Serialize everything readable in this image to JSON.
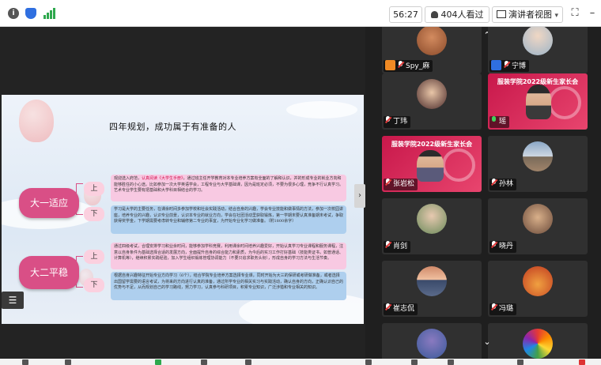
{
  "topbar": {
    "info_icon": "i",
    "shield_icon": "shield-icon",
    "signal_icon": "signal-icon",
    "timer": "56:27",
    "viewers": "404人看过",
    "presenter_view_label": "演讲者视图",
    "presenter_view_caret": "▾",
    "fullscreen_icon": "⛶",
    "minimize_icon": "–"
  },
  "slide": {
    "title": "四年规划，成功属于有准备的人",
    "menu_icon": "☰",
    "year1": {
      "label": "大一适应",
      "term1_label": "上",
      "term2_label": "下",
      "term1_text_pre": "观迎选入府范，",
      "term1_text_highlight": "认真阅读《大学生手册》",
      "term1_text_post": "，通过班主任开学教育对本专业培养方案有全面的了解和认识，并的形成专业的就业方向和能够胜任的小心途。比如参加一次大学英语学会，工程专业与大学基础课，因为是班定必须，不要为很多心理，竞争不行认真学习。艺术专业学生要有把基础和大学科目相结合的学习。",
      "term2_text": "学习是大学的主要任务，在课余时间多参加学校和社会实践活动，结合自身的兴趣，学会专业技能和做事情的方法，参加一次校园讲座，培养专业的兴趣，认识专业前景，认识本专业的就业方向，学会在社团活动里获取锻炼，第一学期末要认真准备期末考试，争取获得奖学金，下学期需要考虑转专业和辅修第二专业的事宜，为开始专业化学习做准备。（附1800余字）"
    },
    "year2": {
      "label": "大二平稳",
      "term1_label": "上",
      "term2_label": "下",
      "term1_text": "通过四级考试，合理安排学习和业余时间，能够参加学科竞赛，利用课余时间培养兴趣爱好，开始认真学习专业课程和服务课程，注意以自身条件为基础选择合适的发展方向，全面提升自身的综合能力和素质，为今后的实习工作打好基础（技能类证书，如普通话、计算机等），继续积累实践经验，加入学生组织锻炼管理协调能力（不要只追求职务头衔），形成自身的学习方法与生活节奏。",
      "term2_text": "根据自身兴趣特征开始专业方向学习（6个），结合学院专业培养方案选择专业课，同时开始为大三的保研或考研做准备，或者选择出国留学需要的语言考试，为将来的方向进行认真的准备，通过所学专业的相关实习与实践活动，确认自身的方向，正确认识自己的优势与不足，从而规划自己的学习路线，努力学习，认真参与科研项目，积累专业知识，广泛涉猎和专业相关的知识。"
    }
  },
  "video_panel": {
    "scroll_up_icon": "⌃",
    "scroll_down_icon": "⌄",
    "tiles": [
      {
        "name": "Spy_麻",
        "mic": "off",
        "badge": "orange"
      },
      {
        "name": "宁博",
        "mic": "off",
        "badge": "blue"
      },
      {
        "name": "丁玮",
        "mic": "off"
      },
      {
        "name": "瑶",
        "mic": "on",
        "banner": "服装学院2022级新生家长会"
      },
      {
        "name": "张岩松",
        "mic": "off",
        "banner": "服装学院2022级新生家长会"
      },
      {
        "name": "孙林",
        "mic": "off"
      },
      {
        "name": "肖剑",
        "mic": "off"
      },
      {
        "name": "晓丹",
        "mic": "off"
      },
      {
        "name": "崔志侃",
        "mic": "off"
      },
      {
        "name": "冯璐",
        "mic": "off"
      },
      {
        "name": "",
        "mic": "off"
      },
      {
        "name": "",
        "mic": "off"
      }
    ]
  },
  "colors": {
    "accent_pink": "#d94f86",
    "banner_red": "#c8184b",
    "signal_green": "#2ea84d"
  }
}
